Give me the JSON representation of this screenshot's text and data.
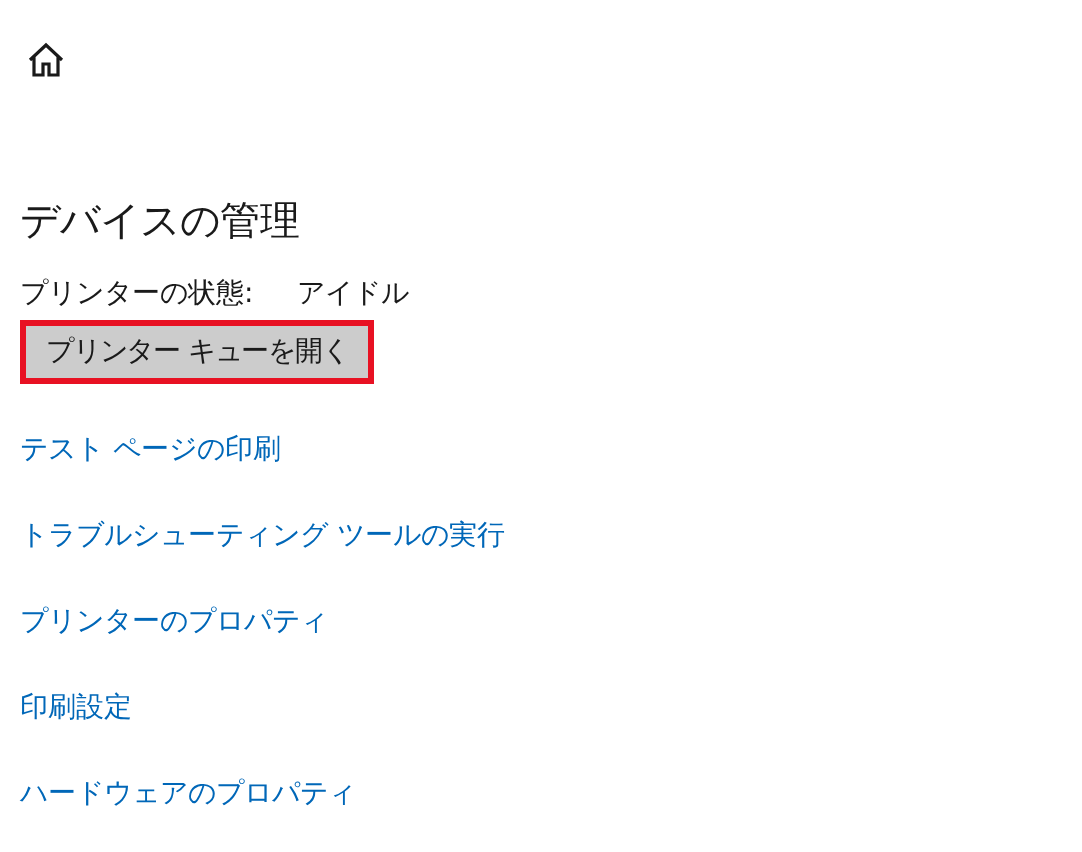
{
  "heading": "デバイスの管理",
  "status": {
    "label": "プリンターの状態:",
    "value": "アイドル"
  },
  "button": {
    "label": "プリンター キューを開く",
    "highlighted": true
  },
  "links": [
    "テスト ページの印刷",
    "トラブルシューティング ツールの実行",
    "プリンターのプロパティ",
    "印刷設定",
    "ハードウェアのプロパティ"
  ]
}
